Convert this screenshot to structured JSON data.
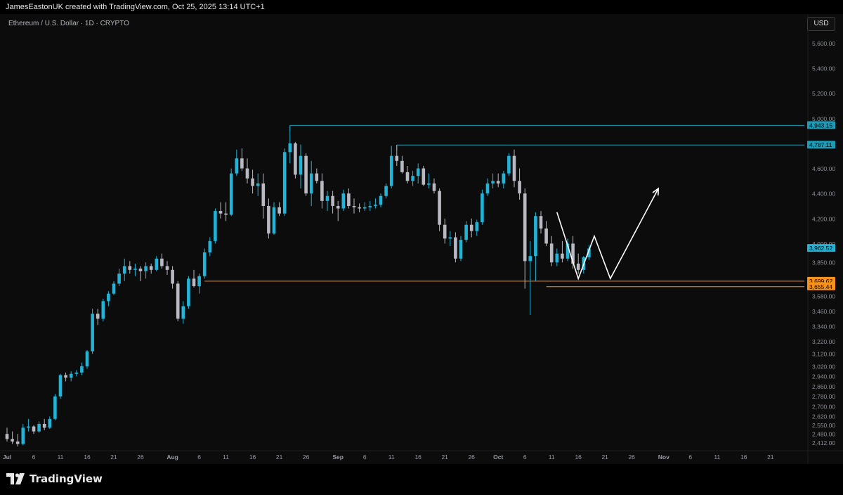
{
  "header": {
    "attribution": "JamesEastonUK created with TradingView.com, Oct 25, 2025 13:14 UTC+1"
  },
  "symbol_label": "Ethereum / U.S. Dollar · 1D · CRYPTO",
  "currency_button": "USD",
  "branding": {
    "logo_text": "TradingView"
  },
  "colors": {
    "up": "#22b3d6",
    "down": "#b9b9c3",
    "resistance": "#1d9bb7",
    "support": "#f7931a",
    "arrow": "#ffffff"
  },
  "chart_data": {
    "type": "candlestick",
    "title": "Ethereum / U.S. Dollar · 1D · CRYPTO",
    "ylim": [
      2380,
      5720
    ],
    "y_ticks": [
      5600,
      5400,
      5200,
      5000,
      4800,
      4600,
      4400,
      4200,
      4000,
      3850,
      3580,
      3460,
      3340,
      3220,
      3120,
      3020,
      2940,
      2860,
      2780,
      2700,
      2620,
      2550,
      2480,
      2412
    ],
    "y_tick_labels": [
      "5,600.00",
      "5,400.00",
      "5,200.00",
      "5,000.00",
      "4,800.00",
      "4,600.00",
      "4,400.00",
      "4,200.00",
      "4,000.00",
      "3,850.00",
      "3,580.00",
      "3,460.00",
      "3,340.00",
      "3,220.00",
      "3,120.00",
      "3,020.00",
      "2,940.00",
      "2,860.00",
      "2,780.00",
      "2,700.00",
      "2,620.00",
      "2,550.00",
      "2,480.00",
      "2,412.00"
    ],
    "x_ticks": [
      {
        "label": "Jul",
        "day": 0
      },
      {
        "label": "6",
        "day": 5
      },
      {
        "label": "11",
        "day": 10
      },
      {
        "label": "16",
        "day": 15
      },
      {
        "label": "21",
        "day": 20
      },
      {
        "label": "26",
        "day": 25
      },
      {
        "label": "Aug",
        "day": 31
      },
      {
        "label": "6",
        "day": 36
      },
      {
        "label": "11",
        "day": 41
      },
      {
        "label": "16",
        "day": 46
      },
      {
        "label": "21",
        "day": 51
      },
      {
        "label": "26",
        "day": 56
      },
      {
        "label": "Sep",
        "day": 62
      },
      {
        "label": "6",
        "day": 67
      },
      {
        "label": "11",
        "day": 72
      },
      {
        "label": "16",
        "day": 77
      },
      {
        "label": "21",
        "day": 82
      },
      {
        "label": "26",
        "day": 87
      },
      {
        "label": "Oct",
        "day": 92
      },
      {
        "label": "6",
        "day": 97
      },
      {
        "label": "11",
        "day": 102
      },
      {
        "label": "16",
        "day": 107
      },
      {
        "label": "21",
        "day": 112
      },
      {
        "label": "26",
        "day": 117
      },
      {
        "label": "Nov",
        "day": 123
      },
      {
        "label": "6",
        "day": 128
      },
      {
        "label": "11",
        "day": 133
      },
      {
        "label": "16",
        "day": 138
      },
      {
        "label": "21",
        "day": 143
      }
    ],
    "candles": [
      [
        2480,
        2530,
        2420,
        2440
      ],
      [
        2440,
        2500,
        2400,
        2420
      ],
      [
        2420,
        2480,
        2380,
        2400
      ],
      [
        2400,
        2560,
        2390,
        2530
      ],
      [
        2530,
        2600,
        2500,
        2540
      ],
      [
        2540,
        2550,
        2480,
        2500
      ],
      [
        2500,
        2580,
        2490,
        2560
      ],
      [
        2560,
        2600,
        2510,
        2530
      ],
      [
        2530,
        2620,
        2520,
        2600
      ],
      [
        2600,
        2800,
        2590,
        2780
      ],
      [
        2780,
        2960,
        2760,
        2950
      ],
      [
        2950,
        2970,
        2900,
        2930
      ],
      [
        2930,
        2980,
        2900,
        2960
      ],
      [
        2960,
        2990,
        2940,
        2970
      ],
      [
        2970,
        3050,
        2950,
        3020
      ],
      [
        3020,
        3150,
        3000,
        3140
      ],
      [
        3140,
        3480,
        3120,
        3440
      ],
      [
        3440,
        3480,
        3350,
        3400
      ],
      [
        3400,
        3560,
        3380,
        3540
      ],
      [
        3540,
        3620,
        3500,
        3600
      ],
      [
        3600,
        3700,
        3590,
        3680
      ],
      [
        3680,
        3800,
        3660,
        3760
      ],
      [
        3760,
        3880,
        3700,
        3820
      ],
      [
        3820,
        3860,
        3760,
        3790
      ],
      [
        3790,
        3840,
        3740,
        3800
      ],
      [
        3800,
        3820,
        3700,
        3780
      ],
      [
        3780,
        3850,
        3720,
        3820
      ],
      [
        3820,
        3840,
        3760,
        3790
      ],
      [
        3790,
        3900,
        3780,
        3880
      ],
      [
        3880,
        3920,
        3800,
        3820
      ],
      [
        3820,
        3860,
        3750,
        3790
      ],
      [
        3790,
        3820,
        3640,
        3680
      ],
      [
        3680,
        3700,
        3380,
        3400
      ],
      [
        3400,
        3540,
        3360,
        3500
      ],
      [
        3500,
        3740,
        3480,
        3720
      ],
      [
        3720,
        3790,
        3650,
        3660
      ],
      [
        3660,
        3760,
        3600,
        3740
      ],
      [
        3740,
        3960,
        3720,
        3930
      ],
      [
        3930,
        4050,
        3900,
        4020
      ],
      [
        4020,
        4280,
        4000,
        4260
      ],
      [
        4260,
        4330,
        4200,
        4240
      ],
      [
        4240,
        4330,
        4180,
        4230
      ],
      [
        4230,
        4600,
        4220,
        4560
      ],
      [
        4560,
        4750,
        4540,
        4680
      ],
      [
        4680,
        4760,
        4580,
        4600
      ],
      [
        4600,
        4680,
        4480,
        4520
      ],
      [
        4520,
        4590,
        4400,
        4460
      ],
      [
        4460,
        4560,
        4380,
        4480
      ],
      [
        4480,
        4560,
        4200,
        4300
      ],
      [
        4300,
        4360,
        4040,
        4080
      ],
      [
        4080,
        4330,
        4070,
        4290
      ],
      [
        4290,
        4330,
        4220,
        4240
      ],
      [
        4240,
        4760,
        4220,
        4730
      ],
      [
        4730,
        4943,
        4640,
        4800
      ],
      [
        4800,
        4810,
        4520,
        4550
      ],
      [
        4550,
        4790,
        4440,
        4700
      ],
      [
        4700,
        4720,
        4380,
        4400
      ],
      [
        4400,
        4660,
        4300,
        4560
      ],
      [
        4560,
        4600,
        4480,
        4500
      ],
      [
        4500,
        4560,
        4280,
        4340
      ],
      [
        4340,
        4420,
        4260,
        4380
      ],
      [
        4380,
        4420,
        4240,
        4300
      ],
      [
        4300,
        4340,
        4180,
        4280
      ],
      [
        4280,
        4430,
        4260,
        4400
      ],
      [
        4400,
        4440,
        4280,
        4300
      ],
      [
        4300,
        4360,
        4240,
        4290
      ],
      [
        4290,
        4320,
        4250,
        4280
      ],
      [
        4280,
        4330,
        4260,
        4290
      ],
      [
        4290,
        4340,
        4260,
        4300
      ],
      [
        4300,
        4360,
        4280,
        4310
      ],
      [
        4310,
        4400,
        4290,
        4380
      ],
      [
        4380,
        4480,
        4360,
        4460
      ],
      [
        4460,
        4780,
        4440,
        4700
      ],
      [
        4700,
        4787,
        4620,
        4660
      ],
      [
        4660,
        4700,
        4560,
        4570
      ],
      [
        4570,
        4620,
        4480,
        4500
      ],
      [
        4500,
        4580,
        4460,
        4540
      ],
      [
        4540,
        4640,
        4480,
        4600
      ],
      [
        4600,
        4620,
        4460,
        4470
      ],
      [
        4470,
        4560,
        4440,
        4480
      ],
      [
        4480,
        4520,
        4400,
        4420
      ],
      [
        4420,
        4440,
        4100,
        4150
      ],
      [
        4150,
        4200,
        4000,
        4040
      ],
      [
        4040,
        4100,
        3980,
        4050
      ],
      [
        4050,
        4090,
        3850,
        3880
      ],
      [
        3880,
        4060,
        3860,
        4030
      ],
      [
        4030,
        4180,
        4010,
        4150
      ],
      [
        4150,
        4200,
        4050,
        4100
      ],
      [
        4100,
        4190,
        4060,
        4170
      ],
      [
        4170,
        4430,
        4150,
        4400
      ],
      [
        4400,
        4520,
        4380,
        4480
      ],
      [
        4480,
        4560,
        4440,
        4500
      ],
      [
        4500,
        4560,
        4450,
        4480
      ],
      [
        4480,
        4580,
        4440,
        4560
      ],
      [
        4560,
        4720,
        4540,
        4700
      ],
      [
        4700,
        4750,
        4450,
        4500
      ],
      [
        4500,
        4600,
        4350,
        4400
      ],
      [
        4400,
        4440,
        3640,
        3860
      ],
      [
        3860,
        4020,
        3430,
        3900
      ],
      [
        3900,
        4250,
        3700,
        4220
      ],
      [
        4220,
        4260,
        4080,
        4120
      ],
      [
        4120,
        4180,
        3980,
        4000
      ],
      [
        4000,
        4060,
        3820,
        3850
      ],
      [
        3850,
        3960,
        3820,
        3920
      ],
      [
        3920,
        4020,
        3850,
        3880
      ],
      [
        3880,
        4040,
        3860,
        4000
      ],
      [
        4000,
        4060,
        3800,
        3840
      ],
      [
        3840,
        3920,
        3760,
        3790
      ],
      [
        3790,
        3900,
        3760,
        3890
      ],
      [
        3890,
        3990,
        3870,
        3960
      ]
    ],
    "levels": [
      {
        "name": "resistance-1",
        "value": 4943.15,
        "label": "4,943.15",
        "start_day": 53
      },
      {
        "name": "resistance-2",
        "value": 4787.11,
        "label": "4,787.11",
        "start_day": 73
      },
      {
        "name": "support-1",
        "value": 3699.62,
        "label": "3,699.62",
        "start_day": 37
      },
      {
        "name": "support-2",
        "value": 3655.44,
        "label": "3,655.44",
        "start_day": 101
      }
    ],
    "last_price": {
      "value": 3962.52,
      "label": "3,962.52"
    },
    "projection_path": [
      [
        103,
        4250
      ],
      [
        107,
        3720
      ],
      [
        110,
        4060
      ],
      [
        113,
        3720
      ],
      [
        122,
        4440
      ]
    ]
  }
}
